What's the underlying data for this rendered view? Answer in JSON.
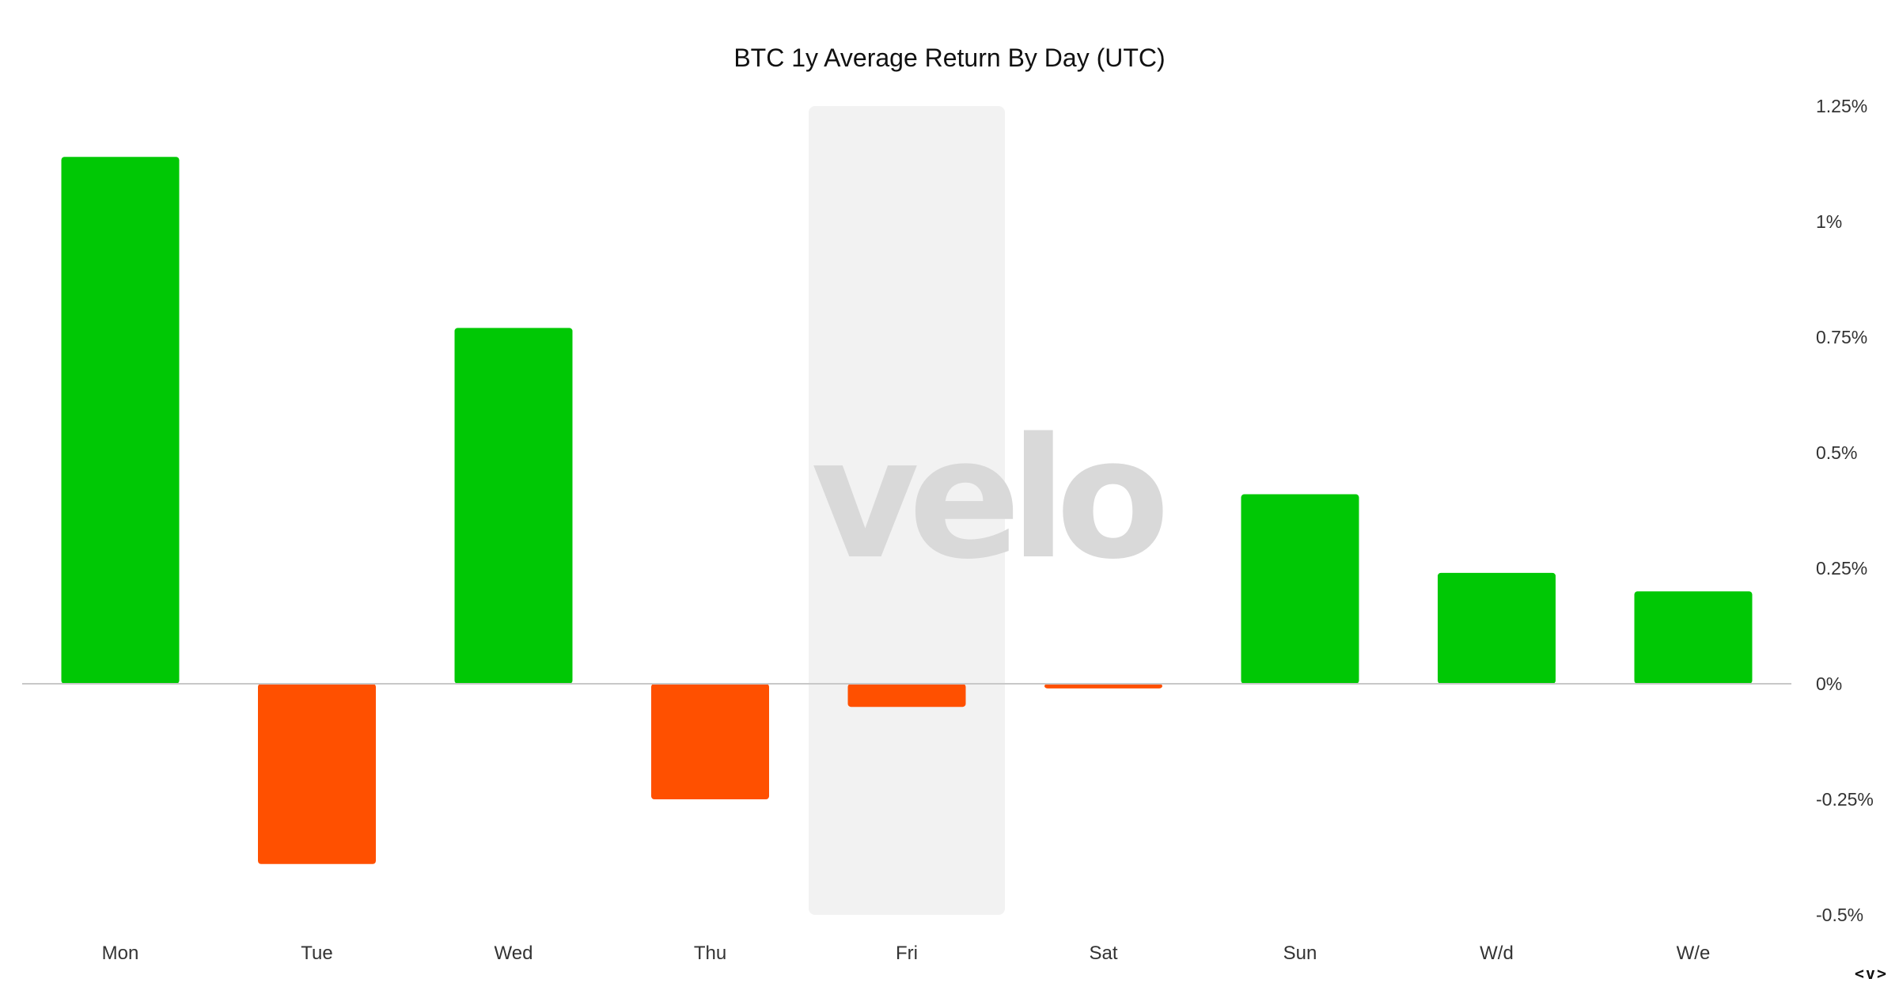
{
  "chart_data": {
    "type": "bar",
    "title": "BTC 1y Average Return By Day (UTC)",
    "categories": [
      "Mon",
      "Tue",
      "Wed",
      "Thu",
      "Fri",
      "Sat",
      "Sun",
      "W/d",
      "W/e"
    ],
    "values": [
      1.14,
      -0.39,
      0.77,
      -0.25,
      -0.05,
      -0.01,
      0.41,
      0.24,
      0.2
    ],
    "unit": "%",
    "xlabel": "",
    "ylabel": "",
    "ylim": [
      -0.5,
      1.25
    ],
    "yticks": [
      1.25,
      1.0,
      0.75,
      0.5,
      0.25,
      0,
      -0.25,
      -0.5
    ],
    "ytick_labels": [
      "1.25%",
      "1%",
      "0.75%",
      "0.5%",
      "0.25%",
      "0%",
      "-0.25%",
      "-0.5%"
    ],
    "y_axis_side": "right",
    "grid": false,
    "highlighted_category": "Fri",
    "colors": {
      "positive": "#00c805",
      "negative": "#ff5000",
      "highlight": "#f2f2f2",
      "zero_line": "#c8c8c8"
    }
  },
  "watermark": "velo",
  "corner_logo": "<v>"
}
